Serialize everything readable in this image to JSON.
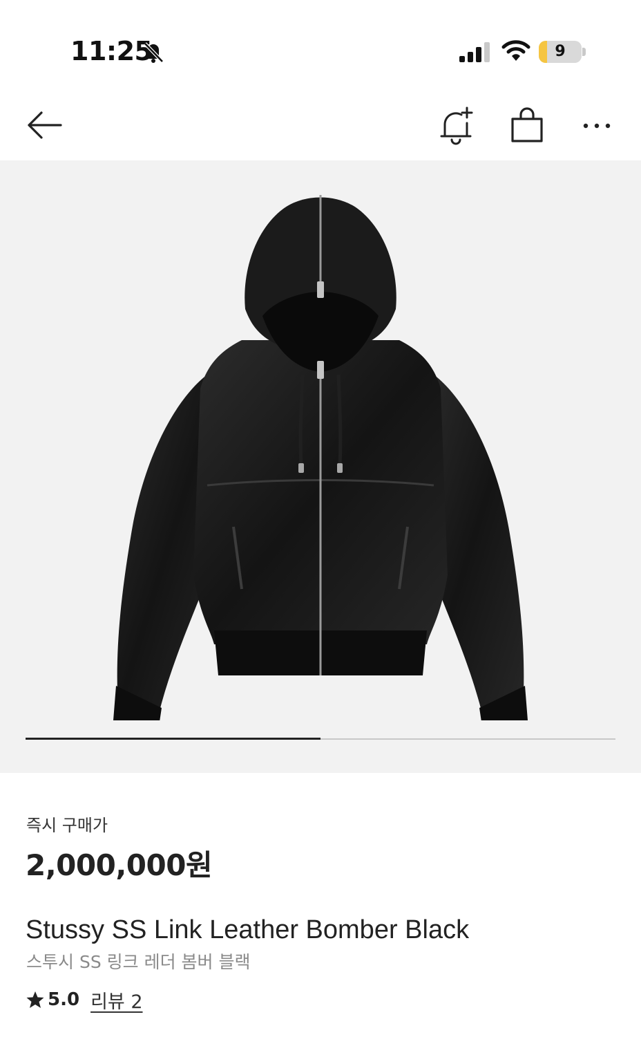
{
  "status_bar": {
    "time": "11:25",
    "battery_level": "9",
    "battery_fraction": 0.2,
    "battery_color": "#f5c542",
    "icons": [
      "bell-off-icon",
      "signal-icon",
      "wifi-icon",
      "battery-icon"
    ]
  },
  "nav": {
    "icons": [
      "back-arrow-icon",
      "bell-plus-icon",
      "shopping-bag-icon",
      "more-dots-icon"
    ]
  },
  "gallery": {
    "image_subject": "black leather hooded zip bomber jacket",
    "current_page": 1,
    "total_pages": 2,
    "progress_fraction": 0.5
  },
  "product": {
    "price_label": "즉시 구매가",
    "price": "2,000,000원",
    "name_en": "Stussy SS Link Leather Bomber Black",
    "name_ko": "스투시 SS 링크 레더 봄버 블랙",
    "rating": "5.0",
    "review_link": "리뷰 2"
  }
}
